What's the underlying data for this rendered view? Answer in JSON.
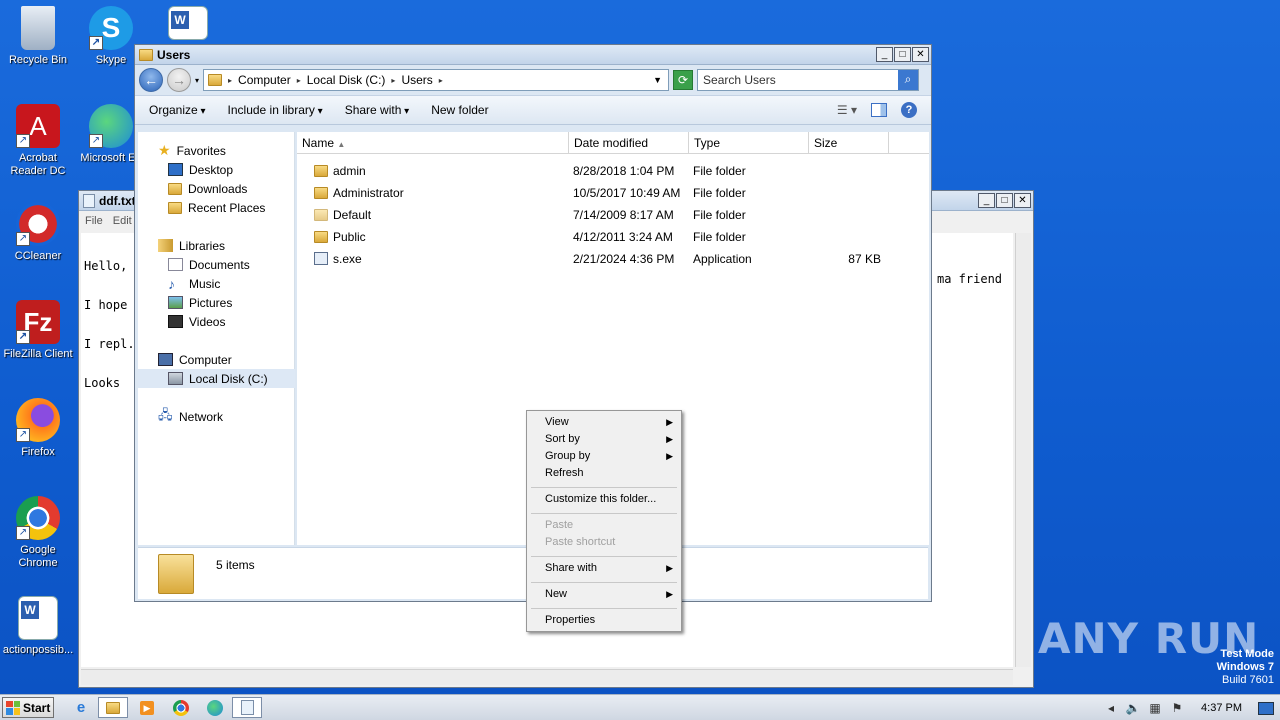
{
  "desktop": {
    "icons": [
      {
        "label": "Recycle Bin",
        "icon": "recycle-bin-icon"
      },
      {
        "label": "Skype",
        "icon": "skype-icon"
      },
      {
        "label": "Acrobat Reader DC",
        "icon": "acrobat-icon"
      },
      {
        "label": "Microsoft Ed",
        "icon": "edge-icon"
      },
      {
        "label": "CCleaner",
        "icon": "ccleaner-icon"
      },
      {
        "label": "FileZilla Client",
        "icon": "filezilla-icon"
      },
      {
        "label": "Firefox",
        "icon": "firefox-icon"
      },
      {
        "label": "Google Chrome",
        "icon": "chrome-icon"
      },
      {
        "label": "actionpossib...",
        "icon": "word-doc-icon"
      }
    ]
  },
  "notepad": {
    "title": "ddf.txt",
    "menu": [
      "File",
      "Edit"
    ],
    "lines": [
      "Hello,",
      "I hope",
      "I repl.",
      "Looks "
    ],
    "line_tail": "ma friend"
  },
  "explorer": {
    "title": "Users",
    "breadcrumb": [
      "Computer",
      "Local Disk (C:)",
      "Users"
    ],
    "search_placeholder": "Search Users",
    "commands": [
      "Organize",
      "Include in library",
      "Share with",
      "New folder"
    ],
    "nav": {
      "favorites": "Favorites",
      "desktop": "Desktop",
      "downloads": "Downloads",
      "recent": "Recent Places",
      "libraries": "Libraries",
      "documents": "Documents",
      "music": "Music",
      "pictures": "Pictures",
      "videos": "Videos",
      "computer": "Computer",
      "localdisk": "Local Disk (C:)",
      "network": "Network"
    },
    "columns": {
      "name": "Name",
      "date": "Date modified",
      "type": "Type",
      "size": "Size"
    },
    "files": [
      {
        "name": "admin",
        "date": "8/28/2018 1:04 PM",
        "type": "File folder",
        "size": ""
      },
      {
        "name": "Administrator",
        "date": "10/5/2017 10:49 AM",
        "type": "File folder",
        "size": ""
      },
      {
        "name": "Default",
        "date": "7/14/2009 8:17 AM",
        "type": "File folder",
        "size": ""
      },
      {
        "name": "Public",
        "date": "4/12/2011 3:24 AM",
        "type": "File folder",
        "size": ""
      },
      {
        "name": "s.exe",
        "date": "2/21/2024 4:36 PM",
        "type": "Application",
        "size": "87 KB"
      }
    ],
    "status": "5 items"
  },
  "context_menu": {
    "view": "View",
    "sort_by": "Sort by",
    "group_by": "Group by",
    "refresh": "Refresh",
    "customize": "Customize this folder...",
    "paste": "Paste",
    "paste_shortcut": "Paste shortcut",
    "share_with": "Share with",
    "new": "New",
    "properties": "Properties"
  },
  "taskbar": {
    "start": "Start",
    "clock": "4:37 PM"
  },
  "watermark": "ANY RUN",
  "test_mode": {
    "line1": "Test Mode",
    "line2": "Windows 7",
    "line3": "Build 7601"
  },
  "colors": {
    "desktop": "#1565d8",
    "accent": "#3b78d0"
  }
}
